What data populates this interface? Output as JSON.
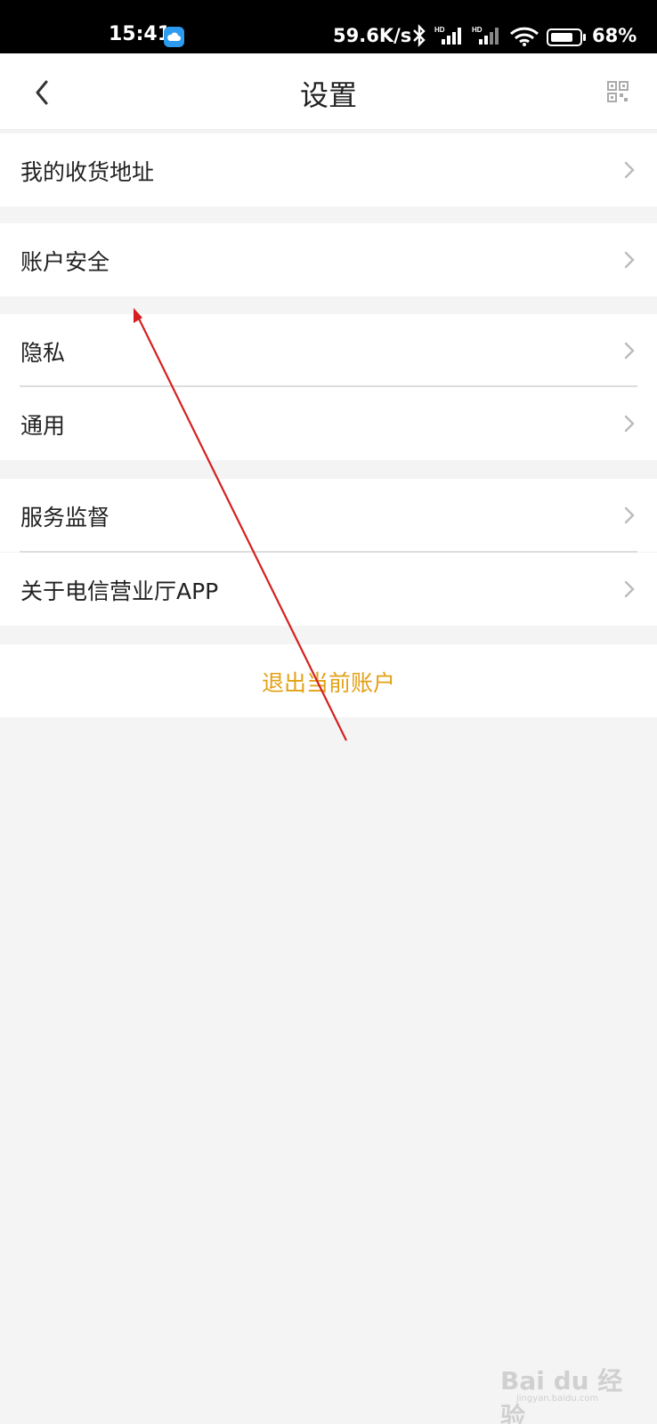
{
  "status_bar": {
    "time": "15:41",
    "network_speed": "59.6K/s",
    "battery_percent": "68%",
    "icons": [
      "cloud-icon",
      "bluetooth-icon",
      "hd-signal-icon",
      "hd-signal-icon",
      "wifi-icon",
      "battery-icon"
    ]
  },
  "header": {
    "title": "设置",
    "back_icon": "chevron-left-icon",
    "right_icon": "qr-code-icon"
  },
  "menu": {
    "items": [
      {
        "label": "我的收货地址"
      },
      {
        "label": "账户安全"
      },
      {
        "label": "隐私"
      },
      {
        "label": "通用"
      },
      {
        "label": "服务监督"
      },
      {
        "label": "关于电信营业厅APP"
      }
    ],
    "row_icon": "chevron-right-icon"
  },
  "logout": {
    "label": "退出当前账户",
    "color": "#e3a116"
  },
  "annotation": {
    "arrow_color": "#d42020"
  },
  "watermark": {
    "text": "Bai du 经验",
    "sub": "jingyan.baidu.com"
  }
}
